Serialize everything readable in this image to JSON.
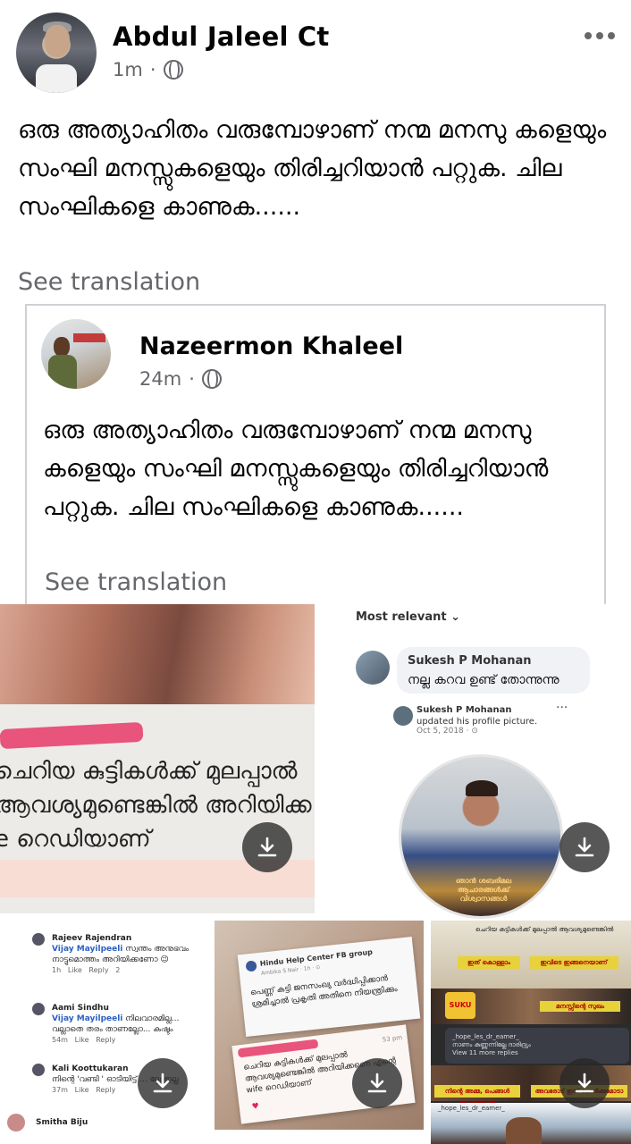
{
  "post": {
    "author": "Abdul Jaleel Ct",
    "time": "1m",
    "separator": "·",
    "privacy_icon": "globe-icon",
    "text": "ഒരു അത്യാഹിതം വരുമ്പോഴാണ് നന്മ മനസു കളെയും സംഘി മനസ്സുകളെയും തിരിച്ചറിയാൻ പറ്റുക. ചില സംഘികളെ കാണുക......",
    "see_translation": "See translation",
    "more_icon": "more-options-icon"
  },
  "shared": {
    "author": "Nazeermon Khaleel",
    "time": "24m",
    "separator": "·",
    "text": "ഒരു അത്യാഹിതം വരുമ്പോഴാണ് നന്മ മനസു കളെയും സംഘി മനസ്സുകളെയും തിരിച്ചറിയാൻ പറ്റുക. ചില സംഘികളെ കാണുക......",
    "see_translation": "See translation"
  },
  "images": {
    "img1": {
      "lines": [
        "ചെറിയ കുട്ടികൾക്ക് മുലപ്പാൽ",
        "ആവശ്യമുണ്ടെങ്കിൽ അറിയിക്ക",
        "e റെഡിയാണ്"
      ]
    },
    "img2": {
      "sort_label": "Most relevant ⌄",
      "comment_name": "Sukesh P Mohanan",
      "comment_text": "നല്ല കറവ ഉണ്ട് തോന്നുന്നു",
      "update_name": "Sukesh P Mohanan",
      "update_text": "updated his profile picture.",
      "update_date": "Oct 5, 2018 · ⊙",
      "dots": "···",
      "frame_text": "ഞാൻ ശബരിമല ആചാരങ്ങൾക്ക് വിശ്വാസങ്ങൾ"
    },
    "img3": {
      "comments": [
        {
          "name": "Rajeev Rajendran",
          "mention": "Vijay Mayilpeeli",
          "text": "സ്വന്തം അനുഭവം നാട്ടുമൊത്തം അറിയിക്കണോ 😉",
          "time": "1h",
          "like": "Like",
          "reply": "Reply",
          "count": "2"
        },
        {
          "name": "Aami Sindhu",
          "mention": "Vijay Mayilpeeli",
          "text": "നിലവാരമില്ല... വല്ലാതെ തരം താണല്ലോ... കഷ്ടം",
          "time": "54m",
          "like": "Like",
          "reply": "Reply",
          "count": ""
        },
        {
          "name": "Kali Koottukaran",
          "mention": "",
          "text": "നിന്റെ 'വണ്ടി ' ഓടിയിട്ട് ... ല്ലേ ഇല്ല",
          "time": "37m",
          "like": "Like",
          "reply": "Reply",
          "count": ""
        },
        {
          "name": "Smitha Biju",
          "mention": "",
          "text": "",
          "time": "",
          "like": "",
          "reply": "",
          "count": ""
        }
      ]
    },
    "img4": {
      "group": "Hindu Help Center FB group",
      "sub": "Ambika S Nair · 1h · ⊙",
      "post_text": "പെണ്ണ് കുട്ടി ജനസംഖ്യ വർദ്ധിപ്പിക്കാൻ ശ്രമിച്ചാൽ പ്രകൃതി അതിനെ നിയന്ത്രിക്കും",
      "msg_text": "ചെറിയ കുട്ടികൾക്ക് മുലപ്പാൽ ആവശ്യമുണ്ടെങ്കിൽ അറിയിക്കണെ എന്റെ wife റെഡിയാണ്",
      "msg_time": "53 pm",
      "heart": "♥"
    },
    "img5": {
      "top_text": "ചെറിയ കുട്ടികൾക്ക് മുലപ്പാൽ ആവശ്യമുണ്ടെങ്കിൽ",
      "caption1": "ഇത് കൊള്ളാം",
      "caption2": "ഇവിടെ ഇങ്ങനെയാണ്",
      "badge": "SUKU CHA",
      "caption3": "മനസ്സിന്റെ സുഖം",
      "comment_name": "_hope_les_dr_eamer_",
      "comment_text": "നാണം കുണ്ണുന്നില്ലേ ദാരിദ്ര്യം",
      "reply_link": "View 11 more replies",
      "caption4": "നിന്റെ അമ്മ, പെങ്ങൾ ആണെങ്കിൽ",
      "caption5": "അവരോട് ഇത് ചോദിക്കുമോടാ",
      "bottom_name": "_hope_les_dr_eamer_"
    },
    "download_icon": "download-icon"
  }
}
